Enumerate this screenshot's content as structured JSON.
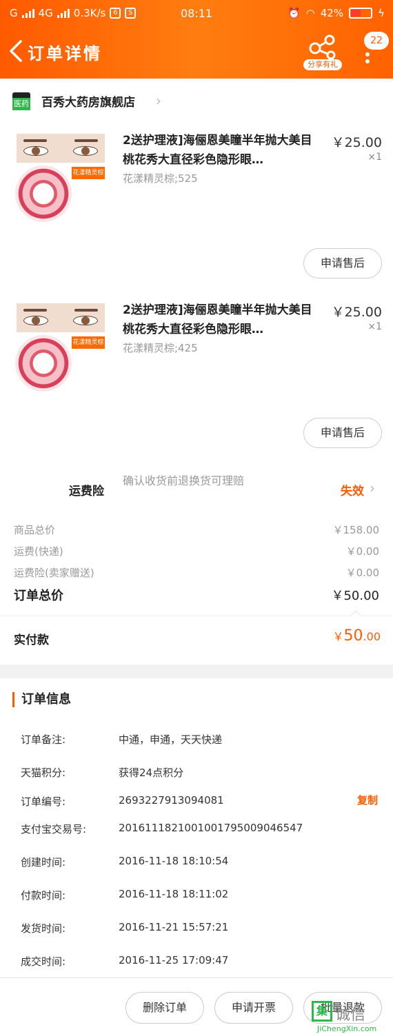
{
  "status_bar": {
    "carrier": "G",
    "network": "4G",
    "speed": "0.3K/s",
    "time": "08:11",
    "battery": "42%"
  },
  "nav": {
    "title": "订单详情",
    "share_label": "分享有礼",
    "badge_count": "22"
  },
  "shop": {
    "badge": "医药",
    "name": "百秀大药房旗舰店"
  },
  "items": [
    {
      "title": "2送护理液]海俪恩美瞳半年抛大美目桃花秀大直径彩色隐形眼…",
      "spec": "花漾精灵棕;525",
      "price": "￥25.00",
      "qty": "×1",
      "image_tag": "花漾精灵棕",
      "after_sale": "申请售后"
    },
    {
      "title": "2送护理液]海俪恩美瞳半年抛大美目桃花秀大直径彩色隐形眼…",
      "spec": "花漾精灵棕;425",
      "price": "￥25.00",
      "qty": "×1",
      "image_tag": "花漾精灵棕",
      "after_sale": "申请售后"
    }
  ],
  "freight_insurance": {
    "label": "运费险",
    "desc": "确认收货前退换货可理赔",
    "status": "失效"
  },
  "summary": {
    "goods_total_label": "商品总价",
    "goods_total": "￥158.00",
    "shipping_label": "运费(快递)",
    "shipping": "￥0.00",
    "insurance_label": "运费险(卖家赠送)",
    "insurance": "￥0.00",
    "order_total_label": "订单总价",
    "order_total": "￥50.00"
  },
  "paid": {
    "label": "实付款",
    "currency": "￥",
    "amount_int": "50",
    "amount_dec": ".00"
  },
  "order_info": {
    "title": "订单信息",
    "copy_label": "复制",
    "rows": [
      {
        "key": "订单备注:",
        "value": "中通，申通，天天快递"
      },
      {
        "key": "天猫积分:",
        "value": "获得24点积分"
      },
      {
        "key": "订单编号:",
        "value": "2693227913094081"
      },
      {
        "key": "支付宝交易号:",
        "value": "2016111821001001795009046547"
      },
      {
        "key": "创建时间:",
        "value": "2016-11-18 18:10:54"
      },
      {
        "key": "付款时间:",
        "value": "2016-11-18 18:11:02"
      },
      {
        "key": "发货时间:",
        "value": "2016-11-21 15:57:21"
      },
      {
        "key": "成交时间:",
        "value": "2016-11-25 17:09:47"
      }
    ]
  },
  "bottom_bar": {
    "delete": "删除订单",
    "invoice": "申请开票",
    "refund": "批量退款"
  },
  "watermark": {
    "box": "集",
    "cn": "诚信",
    "url": "JiChengXin.com"
  },
  "colors": {
    "accent": "#ff5a00",
    "header_start": "#ff5a00",
    "header_end": "#ff7d10",
    "green": "#2db84b"
  }
}
